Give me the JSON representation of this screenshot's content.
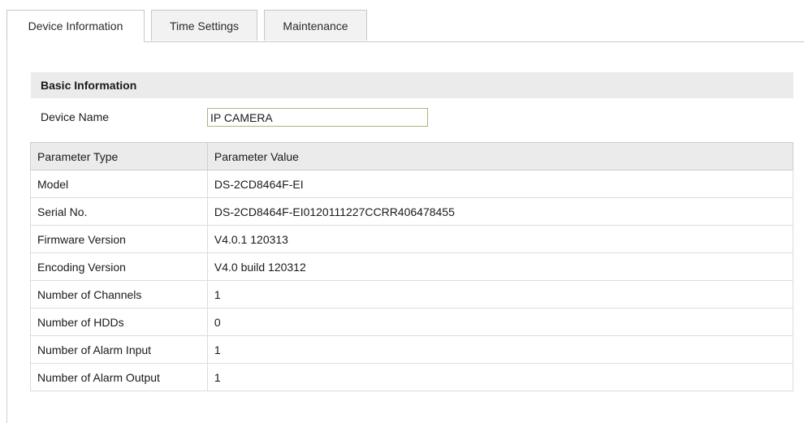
{
  "tabs": [
    {
      "label": "Device Information",
      "active": true
    },
    {
      "label": "Time Settings",
      "active": false
    },
    {
      "label": "Maintenance",
      "active": false
    }
  ],
  "basic_info": {
    "section_title": "Basic Information",
    "device_name_label": "Device Name",
    "device_name_value": "IP CAMERA"
  },
  "table": {
    "headers": [
      "Parameter Type",
      "Parameter Value"
    ],
    "rows": [
      [
        "Model",
        "DS-2CD8464F-EI"
      ],
      [
        "Serial No.",
        "DS-2CD8464F-EI0120111227CCRR406478455"
      ],
      [
        "Firmware Version",
        "V4.0.1 120313"
      ],
      [
        "Encoding Version",
        "V4.0 build 120312"
      ],
      [
        "Number of Channels",
        "1"
      ],
      [
        "Number of HDDs",
        "0"
      ],
      [
        "Number of Alarm Input",
        "1"
      ],
      [
        "Number of Alarm Output",
        "1"
      ]
    ]
  },
  "colors": {
    "tab_border": "#c8c8c8",
    "header_bg": "#ebebeb",
    "input_border": "#a3b87a"
  }
}
